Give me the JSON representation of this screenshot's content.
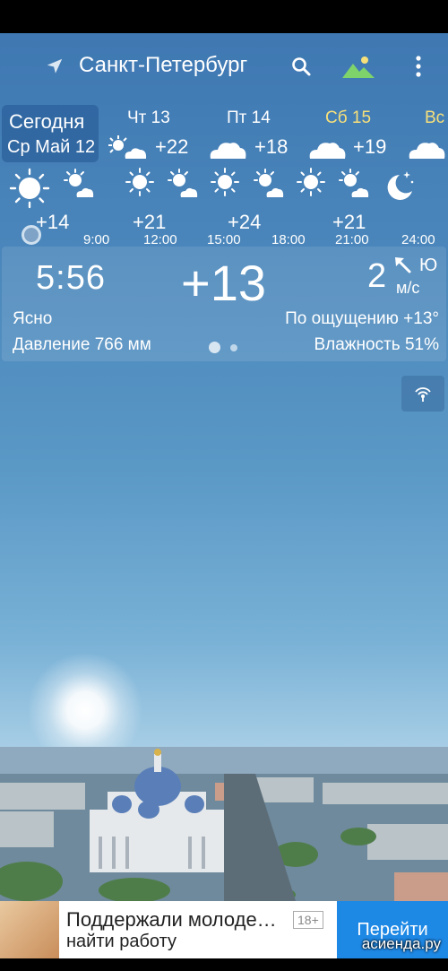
{
  "topbar": {
    "city": "Санкт-Петербург",
    "icons": [
      "location-arrow-icon",
      "search-icon",
      "landscape-icon",
      "more-vert-icon"
    ]
  },
  "days": {
    "today": {
      "line1": "Сегодня",
      "line2": "Ср Май 12"
    },
    "items": [
      {
        "name": "Чт 13",
        "temp": "+22",
        "icon": "sun-cloud-icon"
      },
      {
        "name": "Пт 14",
        "temp": "+18",
        "icon": "cloud-icon"
      },
      {
        "name": "Сб 15",
        "temp": "+19",
        "icon": "cloud-icon",
        "highlight": "#f7e07a"
      },
      {
        "name": "Вс",
        "temp": "",
        "icon": "cloud-icon",
        "highlight": "#f7e07a"
      }
    ]
  },
  "hours": {
    "temps": [
      "+14",
      "+21",
      "+24",
      "+21"
    ],
    "times": [
      "9:00",
      "12:00",
      "15:00",
      "18:00",
      "21:00",
      "24:00"
    ]
  },
  "current": {
    "time": "5:56",
    "temp": "+13",
    "wind_speed": "2",
    "wind_dir": "Ю",
    "wind_unit": "м/с",
    "condition": "Ясно",
    "feels_like": "По ощущению +13°",
    "pressure": "Давление 766 мм",
    "humidity": "Влажность 51%"
  },
  "ad": {
    "title": "Поддержали молоде…",
    "subtitle": "найти работу",
    "age": "18+",
    "cta": "Перейти"
  },
  "watermark": "асиенда.ру",
  "colors": {
    "accent_yellow": "#f7e07a",
    "ad_button": "#1e88e5",
    "sky_top": "#3f78b2"
  }
}
